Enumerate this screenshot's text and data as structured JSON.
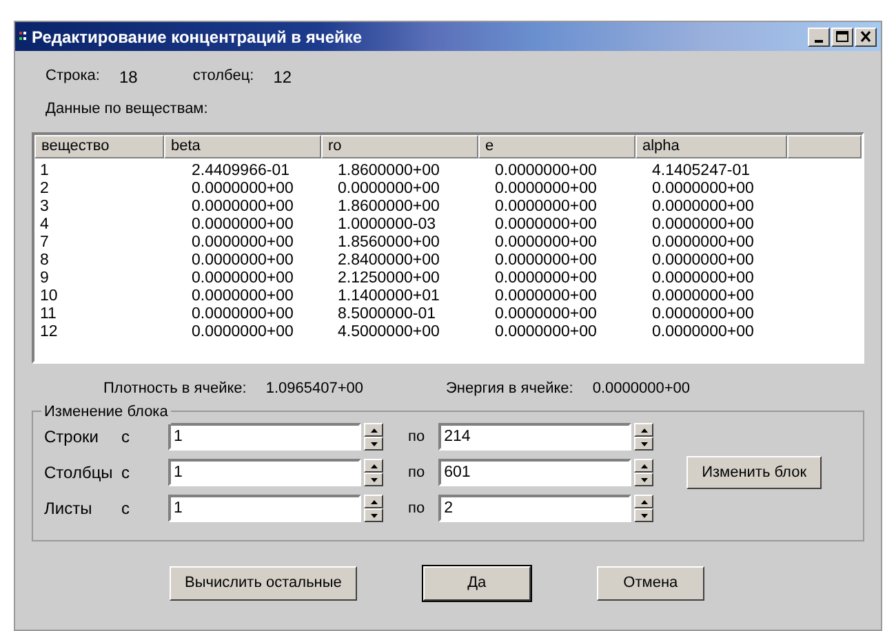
{
  "window": {
    "title": "Редактирование концентраций в ячейке"
  },
  "cell": {
    "row_label": "Строка:",
    "row_value": "18",
    "col_label": "столбец:",
    "col_value": "12"
  },
  "section_label": "Данные по веществам:",
  "table": {
    "columns": [
      "вещество",
      "beta",
      "ro",
      "e",
      "alpha"
    ],
    "rows": [
      [
        "1",
        "2.4409966-01",
        "1.8600000+00",
        "0.0000000+00",
        "4.1405247-01"
      ],
      [
        "2",
        "0.0000000+00",
        "0.0000000+00",
        "0.0000000+00",
        "0.0000000+00"
      ],
      [
        "3",
        "0.0000000+00",
        "1.8600000+00",
        "0.0000000+00",
        "0.0000000+00"
      ],
      [
        "4",
        "0.0000000+00",
        "1.0000000-03",
        "0.0000000+00",
        "0.0000000+00"
      ],
      [
        "7",
        "0.0000000+00",
        "1.8560000+00",
        "0.0000000+00",
        "0.0000000+00"
      ],
      [
        "8",
        "0.0000000+00",
        "2.8400000+00",
        "0.0000000+00",
        "0.0000000+00"
      ],
      [
        "9",
        "0.0000000+00",
        "2.1250000+00",
        "0.0000000+00",
        "0.0000000+00"
      ],
      [
        "10",
        "0.0000000+00",
        "1.1400000+01",
        "0.0000000+00",
        "0.0000000+00"
      ],
      [
        "11",
        "0.0000000+00",
        "8.5000000-01",
        "0.0000000+00",
        "0.0000000+00"
      ],
      [
        "12",
        "0.0000000+00",
        "4.5000000+00",
        "0.0000000+00",
        "0.0000000+00"
      ]
    ]
  },
  "summary": [
    {
      "label": "Плотность в ячейке:",
      "value": "1.0965407+00"
    },
    {
      "label": "Энергия в ячейке:",
      "value": "0.0000000+00"
    }
  ],
  "block": {
    "title": "Изменение блока",
    "rows": [
      {
        "label": "Строки",
        "from_label": "с",
        "from": "1",
        "to_label": "по",
        "to": "214"
      },
      {
        "label": "Столбцы",
        "from_label": "с",
        "from": "1",
        "to_label": "по",
        "to": "601"
      },
      {
        "label": "Листы",
        "from_label": "с",
        "from": "1",
        "to_label": "по",
        "to": "2"
      }
    ],
    "apply_button": "Изменить блок"
  },
  "buttons": [
    {
      "label": "Вычислить остальные",
      "default": false
    },
    {
      "label": "Да",
      "default": true
    },
    {
      "label": "Отмена",
      "default": false
    }
  ]
}
